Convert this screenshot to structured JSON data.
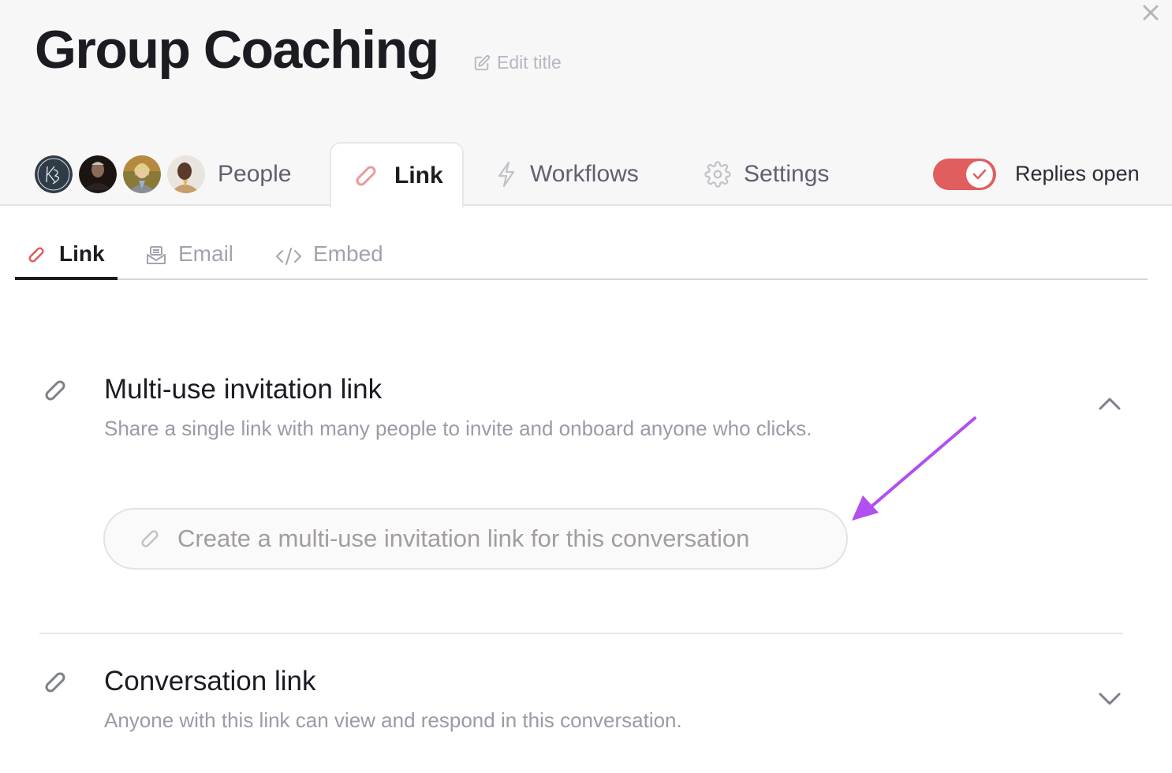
{
  "header": {
    "title": "Group Coaching",
    "edit_title_label": "Edit title",
    "close_icon": "close-icon"
  },
  "tabs": [
    {
      "label": "People",
      "icon": "avatars",
      "active": false
    },
    {
      "label": "Link",
      "icon": "link-icon",
      "active": true
    },
    {
      "label": "Workflows",
      "icon": "lightning-icon",
      "active": false
    },
    {
      "label": "Settings",
      "icon": "gear-icon",
      "active": false
    }
  ],
  "avatars": [
    {
      "initials": "KB",
      "kind": "monogram"
    },
    {
      "kind": "photo"
    },
    {
      "kind": "photo"
    },
    {
      "kind": "photo"
    }
  ],
  "replies_toggle": {
    "label": "Replies open",
    "on": true
  },
  "subtabs": [
    {
      "label": "Link",
      "icon": "link-icon",
      "active": true
    },
    {
      "label": "Email",
      "icon": "email-icon",
      "active": false
    },
    {
      "label": "Embed",
      "icon": "code-icon",
      "active": false
    }
  ],
  "sections": [
    {
      "title": "Multi-use invitation link",
      "description": "Share a single link with many people to invite and onboard anyone who clicks.",
      "expanded": true,
      "button_label": "Create a multi-use invitation link for this conversation"
    },
    {
      "title": "Conversation link",
      "description": "Anyone with this link can view and respond in this conversation.",
      "expanded": false
    }
  ],
  "colors": {
    "accent": "#e05e5e",
    "annotation_arrow": "#b14ff0",
    "text_primary": "#1b1c22",
    "text_muted": "#9a9ba6"
  }
}
